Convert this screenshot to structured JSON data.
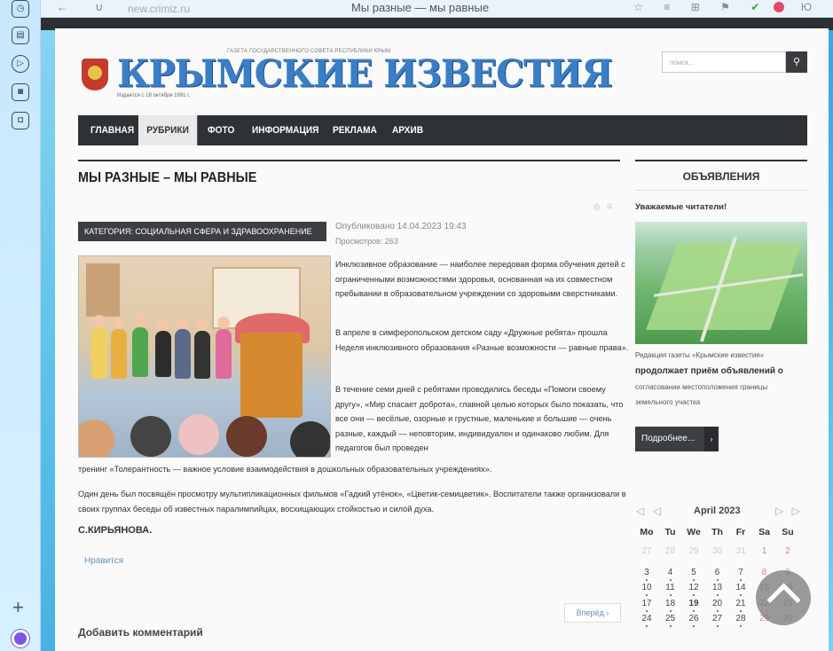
{
  "browser": {
    "url": "new.crimiz.ru",
    "title": "Мы разные — мы равные",
    "nav_glyphs": "← ∪",
    "right_glyphs": "☆ ≡ ⊞ ⚑",
    "right_end": "Ю"
  },
  "site": {
    "gazeta": "ГАЗЕТА ГОСУДАРСТВЕННОГО СОВЕТА РЕСПУБЛИКИ КРЫМ",
    "logo": "КРЫМСКИЕ ИЗВЕСТИЯ",
    "since": "Издается с 18 октября 1991 г.",
    "search_placeholder": "поиск...",
    "search_icon": "search-icon"
  },
  "nav": {
    "items": [
      "ГЛАВНАЯ",
      "РУБРИКИ",
      "ФОТО",
      "ИНФОРМАЦИЯ",
      "РЕКЛАМА",
      "АРХИВ"
    ],
    "active": "РУБРИКИ"
  },
  "article": {
    "title": "МЫ РАЗНЫЕ – МЫ РАВНЫЕ",
    "category": "КАТЕГОРИЯ: СОЦИАЛЬНАЯ СФЕРА И ЗДРАВООХРАНЕНИЕ",
    "published": "Опубликовано 14.04.2023 19:43",
    "views": "Просмотров: 263",
    "p1": "Инклюзивное образование — наиболее передовая форма обучения детей с ограниченными возможностями здоровья, основанная на их совместном пребывании в образовательном учреждении со здоровыми сверстниками.",
    "p2": "В апреле в симферопольском детском саду «Дружные ребята» прошла Неделя инклюзивного образования «Разные возможности — равные права».",
    "p3": "В течение семи дней с ребятами проводились беседы «Помоги своему другу», «Мир спасает доброта», главной целью которых было показать, что все они — весёлые, озорные и грустные, маленькие и большие — очень разные, каждый — неповторим, индивидуален и одинаково любим. Для педагогов был проведен",
    "p3_end": "тренинг «Толерантность — важное условие взаимодействия в дошкольных образовательных учреждениях».",
    "p4": "Один день был посвящён просмотру мультипликационных фильмов «Гадкий утёнок», «Цветик-семицветик». Воспитатели также организовали в своих группах беседы об известных паралимпийцах, восхищающих стойкостью и силой духа.",
    "author": "С.КИРЬЯНОВА.",
    "like": "Нравится",
    "next": "Вперёд ›",
    "add_comment": "Добавить комментарий"
  },
  "sidebar": {
    "title": "ОБЪЯВЛЕНИЯ",
    "greeting": "Уважаемые читатели!",
    "line1": "Редакция газеты «Крымские известия»",
    "line2": "продолжает приём объявлений о",
    "line3": "согласовании местоположения границы",
    "line4": "земельного участка",
    "more": "Подробнее...",
    "more_arrow": "›"
  },
  "calendar": {
    "month": "April 2023",
    "prev": "◁ ◁",
    "next": "▷ ▷",
    "headers": [
      "Mo",
      "Tu",
      "We",
      "Th",
      "Fr",
      "Sa",
      "Su"
    ],
    "rows": [
      [
        "27",
        "28",
        "29",
        "30",
        "31",
        "1",
        "2"
      ],
      [
        "3",
        "4",
        "5",
        "6",
        "7",
        "8",
        "9"
      ],
      [
        "10",
        "11",
        "12",
        "13",
        "14",
        "15",
        "16"
      ],
      [
        "17",
        "18",
        "19",
        "20",
        "21",
        "22",
        "23"
      ],
      [
        "24",
        "25",
        "26",
        "27",
        "28",
        "29",
        "30"
      ]
    ],
    "today": "19"
  },
  "colors": {
    "accent_blue": "#3a7ec7",
    "nav_dark": "#2f3235"
  }
}
